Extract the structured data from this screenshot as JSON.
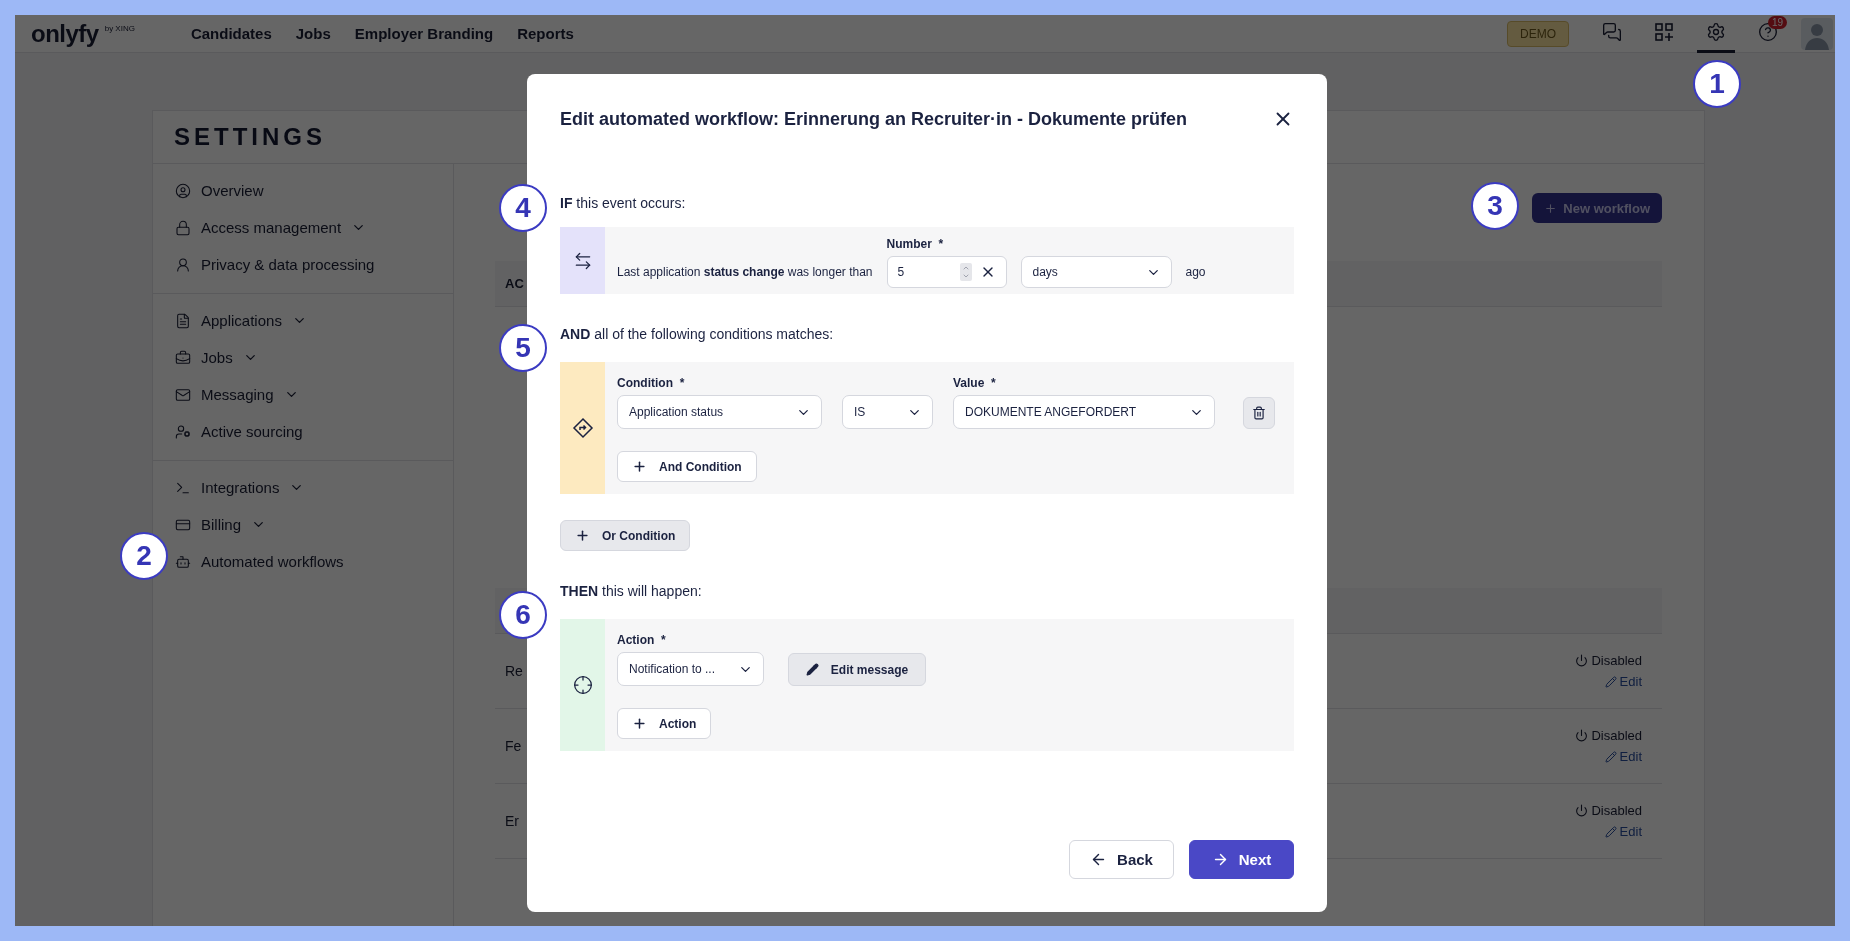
{
  "topbar": {
    "logo": "onlyfy",
    "logo_sub": "by XING",
    "nav": [
      {
        "label": "Candidates"
      },
      {
        "label": "Jobs"
      },
      {
        "label": "Employer Branding"
      },
      {
        "label": "Reports"
      }
    ],
    "demo_badge": "DEMO",
    "icons": [
      {
        "kind": "chat",
        "selected": false
      },
      {
        "kind": "apps",
        "selected": false
      },
      {
        "kind": "settings",
        "selected": true
      },
      {
        "kind": "help",
        "selected": false,
        "badge": "19"
      }
    ]
  },
  "settings": {
    "title": "SETTINGS",
    "sidebar_groups": [
      [
        {
          "label": "Overview",
          "kind": "user",
          "expandable": false
        },
        {
          "label": "Access management",
          "kind": "lock",
          "expandable": true
        },
        {
          "label": "Privacy & data processing",
          "kind": "agent",
          "expandable": false
        }
      ],
      [
        {
          "label": "Applications",
          "kind": "file",
          "expandable": true
        },
        {
          "label": "Jobs",
          "kind": "briefcase",
          "expandable": true
        },
        {
          "label": "Messaging",
          "kind": "mail",
          "expandable": true
        },
        {
          "label": "Active sourcing",
          "kind": "usergear",
          "expandable": false
        }
      ],
      [
        {
          "label": "Integrations",
          "kind": "terminal",
          "expandable": true
        },
        {
          "label": "Billing",
          "kind": "card",
          "expandable": true
        },
        {
          "label": "Automated workflows",
          "kind": "robot",
          "expandable": false
        }
      ]
    ],
    "new_workflow_button": "New workflow",
    "table_header": "AC",
    "rows": [
      {
        "name": "Re",
        "status": "Disabled",
        "edit": "Edit"
      },
      {
        "name": "Fe",
        "status": "Disabled",
        "edit": "Edit"
      },
      {
        "name": "Er",
        "status": "Disabled",
        "edit": "Edit"
      }
    ]
  },
  "modal": {
    "title": "Edit automated workflow: Erinnerung an Recruiter·in - Dokumente prüfen",
    "if_section": {
      "heading": "**IF** this event occurs:",
      "event_text": "Last application **status change** was longer than",
      "number_label": "Number",
      "required_mark": "*",
      "number_value": "5",
      "unit": "days",
      "suffix": "ago"
    },
    "and_section": {
      "heading": "**AND** all of the following conditions matches:",
      "conditions": [
        {
          "condition_label": "Condition",
          "condition_required_mark": "*",
          "condition": "Application status",
          "operator": "IS",
          "value_label": "Value",
          "value_required_mark": "*",
          "value": "DOKUMENTE ANGEFORDERT"
        }
      ],
      "add_button": "And Condition"
    },
    "or_button": "Or Condition",
    "then_section": {
      "heading": "**THEN** this will happen:",
      "actions": [
        {
          "label": "Action",
          "required_mark": "*",
          "value": "Notification to ...",
          "edit_button": "Edit message"
        }
      ],
      "add_button": "Action"
    },
    "back_button": "Back",
    "next_button": "Next"
  },
  "callouts": [
    {
      "number": "1"
    },
    {
      "number": "2"
    },
    {
      "number": "3"
    },
    {
      "number": "4"
    },
    {
      "number": "5"
    },
    {
      "number": "6"
    }
  ]
}
